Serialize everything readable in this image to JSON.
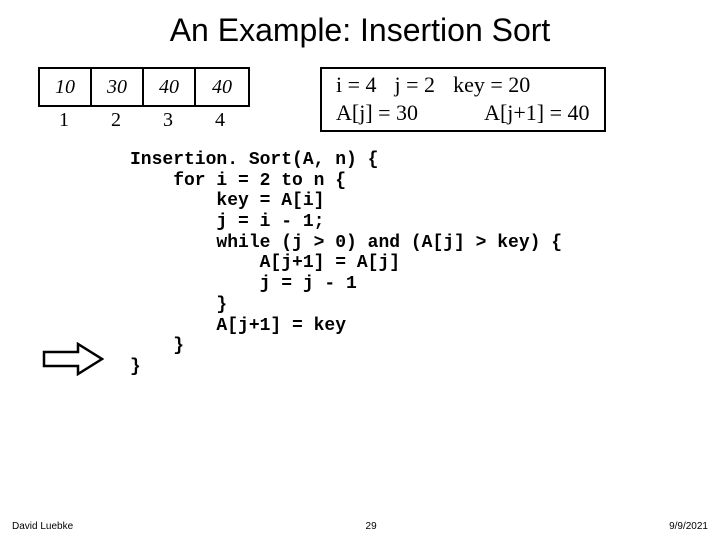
{
  "title": "An Example: Insertion Sort",
  "array": {
    "cells": [
      "10",
      "30",
      "40",
      "40"
    ],
    "indices": [
      "1",
      "2",
      "3",
      "4"
    ]
  },
  "state": {
    "i": "i = 4",
    "j": "j = 2",
    "key": "key = 20",
    "aj": "A[j] = 30",
    "ajp1": "A[j+1] = 40"
  },
  "code": "Insertion. Sort(A, n) {\n    for i = 2 to n {\n        key = A[i]\n        j = i - 1;\n        while (j > 0) and (A[j] > key) {\n            A[j+1] = A[j]\n            j = j - 1\n        }\n        A[j+1] = key\n    }\n}",
  "footer": {
    "author": "David Luebke",
    "page": "29",
    "date": "9/9/2021"
  }
}
